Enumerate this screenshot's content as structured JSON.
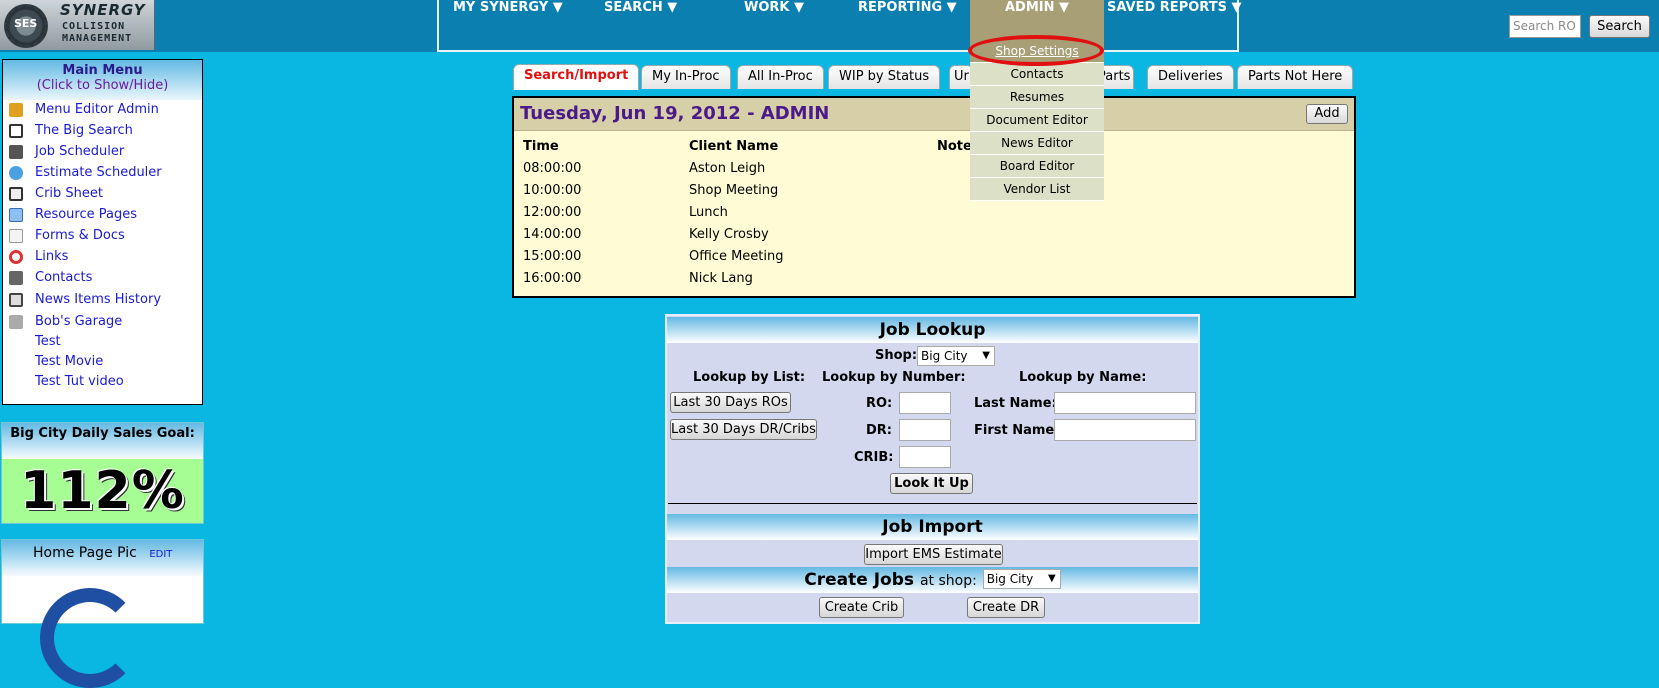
{
  "logo": {
    "mark": "SES",
    "line1": "SYNERGY",
    "line2": "COLLISION",
    "line3": "MANAGEMENT"
  },
  "nav": {
    "items": [
      {
        "label": "MY SYNERGY ▼"
      },
      {
        "label": "SEARCH ▼"
      },
      {
        "label": "WORK ▼"
      },
      {
        "label": "REPORTING ▼"
      },
      {
        "label": "ADMIN ▼",
        "active": true
      },
      {
        "label": "SAVED REPORTS ▼"
      }
    ],
    "search_placeholder": "Search RO",
    "search_button": "Search"
  },
  "admin_dropdown": {
    "items": [
      {
        "label": "Shop Settings",
        "highlighted": true
      },
      {
        "label": "Contacts"
      },
      {
        "label": "Resumes"
      },
      {
        "label": "Document Editor"
      },
      {
        "label": "News Editor"
      },
      {
        "label": "Board Editor"
      },
      {
        "label": "Vendor List"
      }
    ]
  },
  "main_menu": {
    "title": "Main Menu",
    "subtitle": "(Click to Show/Hide)",
    "items": [
      {
        "label": "Menu Editor Admin",
        "icon": "user-edit-icon"
      },
      {
        "label": "The Big Search",
        "icon": "magnifier-icon"
      },
      {
        "label": "Job Scheduler",
        "icon": "scheduler-icon"
      },
      {
        "label": "Estimate Scheduler",
        "icon": "clock-icon"
      },
      {
        "label": "Crib Sheet",
        "icon": "clipboard-icon"
      },
      {
        "label": "Resource Pages",
        "icon": "windows-icon"
      },
      {
        "label": "Forms & Docs",
        "icon": "document-icon"
      },
      {
        "label": "Links",
        "icon": "lifebuoy-icon"
      },
      {
        "label": "Contacts",
        "icon": "address-book-icon"
      },
      {
        "label": "News Items History",
        "icon": "book-icon"
      },
      {
        "label": "Bob's Garage",
        "icon": "tools-icon"
      },
      {
        "label": "Test",
        "icon": ""
      },
      {
        "label": "Test Movie",
        "icon": ""
      },
      {
        "label": "Test Tut video",
        "icon": ""
      }
    ]
  },
  "sales_goal": {
    "title": "Big City Daily Sales Goal:",
    "value": "112%"
  },
  "home_pic": {
    "title": "Home Page Pic",
    "edit": "EDIT"
  },
  "tabs": [
    {
      "label": "Search/Import",
      "active": true
    },
    {
      "label": "My In-Proc"
    },
    {
      "label": "All In-Proc"
    },
    {
      "label": "WIP by Status"
    },
    {
      "label": "Ur"
    },
    {
      "label": "Parts"
    },
    {
      "label": "Deliveries"
    },
    {
      "label": "Parts Not Here"
    }
  ],
  "schedule": {
    "title": "Tuesday, Jun 19, 2012 - ADMIN",
    "add_button": "Add",
    "headers": {
      "time": "Time",
      "client": "Client Name",
      "note": "Note"
    },
    "rows": [
      {
        "time": "08:00:00",
        "client": "Aston Leigh"
      },
      {
        "time": "10:00:00",
        "client": "Shop Meeting"
      },
      {
        "time": "12:00:00",
        "client": "Lunch"
      },
      {
        "time": "14:00:00",
        "client": "Kelly Crosby"
      },
      {
        "time": "15:00:00",
        "client": "Office Meeting"
      },
      {
        "time": "16:00:00",
        "client": "Nick Lang"
      }
    ]
  },
  "job_lookup": {
    "title": "Job Lookup",
    "shop_label": "Shop:",
    "shop_value": "Big City",
    "by_list": "Lookup by List:",
    "by_number": "Lookup by Number:",
    "by_name": "Lookup by Name:",
    "last30_ros": "Last 30 Days ROs",
    "last30_dr": "Last 30 Days DR/Cribs",
    "ro_label": "RO:",
    "dr_label": "DR:",
    "crib_label": "CRIB:",
    "last_name_label": "Last Name:",
    "first_name_label": "First Name:",
    "look_it_up": "Look It Up"
  },
  "job_import": {
    "title": "Job Import",
    "import_button": "Import EMS Estimate"
  },
  "create_jobs": {
    "title": "Create Jobs",
    "at_shop": "at shop:",
    "shop_value": "Big City",
    "create_crib": "Create Crib",
    "create_dr": "Create DR"
  },
  "colors": {
    "page_bg": "#0ab6e2",
    "nav_bg": "#0a7fb0",
    "admin_active": "#a89f77",
    "highlight_ring": "#e01010",
    "schedule_bg": "#fffbd4",
    "lookup_bg": "#d4d8ef"
  }
}
